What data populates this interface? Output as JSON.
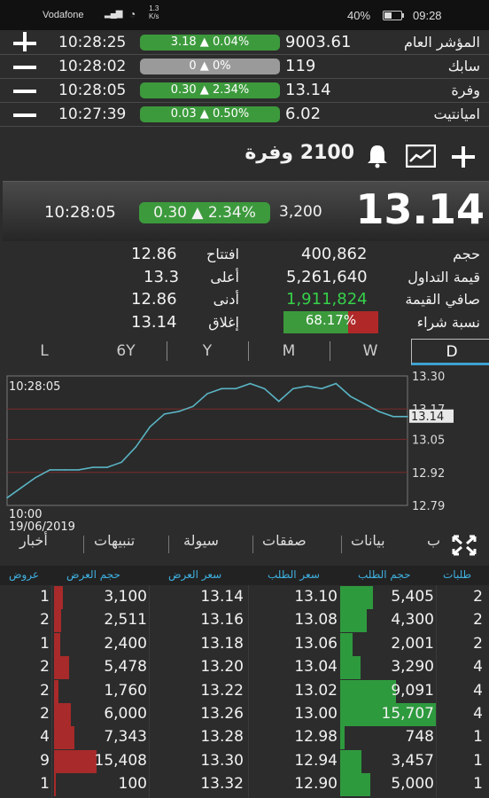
{
  "status_bar": {
    "carrier": "Vodafone",
    "network": "4G",
    "speed_top": "1.3",
    "speed_unit": "K/s",
    "battery": "40%",
    "time": "09:28"
  },
  "watchlist": [
    {
      "action": "plus",
      "time": "10:28:25",
      "change": "3.18 ▲ 0.04%",
      "price": "9003.61",
      "name": "المؤشر العام",
      "state": "up"
    },
    {
      "action": "minus",
      "time": "10:28:02",
      "change": "0 ▲ 0%",
      "price": "119",
      "name": "سابك",
      "state": "flat"
    },
    {
      "action": "minus",
      "time": "10:28:05",
      "change": "0.30 ▲ 2.34%",
      "price": "13.14",
      "name": "وفرة",
      "state": "up"
    },
    {
      "action": "minus",
      "time": "10:27:39",
      "change": "0.03 ▲ 0.50%",
      "price": "6.02",
      "name": "اميانتيت",
      "state": "up"
    }
  ],
  "header": {
    "title": "2100 وفرة"
  },
  "quote": {
    "price": "13.14",
    "volume": "3,200",
    "change": "0.30 ▲ 2.34%",
    "time": "10:28:05"
  },
  "stats": {
    "open_label": "افتتاح",
    "open": "12.86",
    "high_label": "أعلى",
    "high": "13.3",
    "low_label": "أدنى",
    "low": "12.86",
    "close_label": "إغلاق",
    "close": "13.14",
    "volume_label": "حجم",
    "volume": "400,862",
    "value_label": "قيمة التداول",
    "value": "5,261,640",
    "net_label": "صافي القيمة",
    "net": "1,911,824",
    "buy_ratio_label": "نسبة شراء",
    "buy_ratio": "68.17%",
    "buy_ratio_value": 0.6817
  },
  "period_tabs": [
    "L",
    "6Y",
    "Y",
    "M",
    "W",
    "D"
  ],
  "active_period": "D",
  "chart_data": {
    "type": "line",
    "title": "",
    "xlabel": "",
    "ylabel": "",
    "y_ticks": [
      "13.30",
      "13.17",
      "13.05",
      "12.92",
      "12.79"
    ],
    "ylim": [
      12.79,
      13.3
    ],
    "x_start_time": "10:00",
    "x_start_date": "19/06/2019",
    "last_time": "10:28:05",
    "last_value_label": "13.14",
    "x": [
      0,
      1,
      2,
      3,
      4,
      5,
      6,
      7,
      8,
      9,
      10,
      11,
      12,
      13,
      14,
      15,
      16,
      17,
      18,
      19,
      20,
      21,
      22,
      23,
      24,
      25,
      26,
      27,
      28
    ],
    "y": [
      12.82,
      12.86,
      12.9,
      12.93,
      12.93,
      12.93,
      12.94,
      12.94,
      12.96,
      13.02,
      13.1,
      13.15,
      13.16,
      13.18,
      13.23,
      13.25,
      13.25,
      13.27,
      13.25,
      13.2,
      13.25,
      13.26,
      13.25,
      13.27,
      13.22,
      13.19,
      13.16,
      13.14,
      13.14
    ],
    "grid": "horizontal",
    "line_color": "#5ab4c4"
  },
  "data_tabs": [
    "ب",
    "بيانات",
    "صفقات",
    "سيولة",
    "تنبيهات",
    "أخبار"
  ],
  "order_book": {
    "headers": {
      "bid_orders": "طلبات",
      "bid_volume": "حجم الطلب",
      "bid_price": "سعر الطلب",
      "ask_price": "سعر العرض",
      "ask_volume": "حجم العرض",
      "ask_orders": "عروض"
    },
    "rows": [
      {
        "ask_orders": "1",
        "ask_volume": "3,100",
        "ask_price": "13.14",
        "bid_price": "13.10",
        "bid_volume": "5,405",
        "bid_orders": "2",
        "ask_v": 3100,
        "bid_v": 5405
      },
      {
        "ask_orders": "2",
        "ask_volume": "2,511",
        "ask_price": "13.16",
        "bid_price": "13.08",
        "bid_volume": "4,300",
        "bid_orders": "2",
        "ask_v": 2511,
        "bid_v": 4300
      },
      {
        "ask_orders": "1",
        "ask_volume": "2,400",
        "ask_price": "13.18",
        "bid_price": "13.06",
        "bid_volume": "2,001",
        "bid_orders": "2",
        "ask_v": 2400,
        "bid_v": 2001
      },
      {
        "ask_orders": "2",
        "ask_volume": "5,478",
        "ask_price": "13.20",
        "bid_price": "13.04",
        "bid_volume": "3,290",
        "bid_orders": "4",
        "ask_v": 5478,
        "bid_v": 3290
      },
      {
        "ask_orders": "2",
        "ask_volume": "1,760",
        "ask_price": "13.22",
        "bid_price": "13.02",
        "bid_volume": "9,091",
        "bid_orders": "4",
        "ask_v": 1760,
        "bid_v": 9091
      },
      {
        "ask_orders": "2",
        "ask_volume": "6,000",
        "ask_price": "13.26",
        "bid_price": "13.00",
        "bid_volume": "15,707",
        "bid_orders": "4",
        "ask_v": 6000,
        "bid_v": 15707
      },
      {
        "ask_orders": "4",
        "ask_volume": "7,343",
        "ask_price": "13.28",
        "bid_price": "12.98",
        "bid_volume": "748",
        "bid_orders": "1",
        "ask_v": 7343,
        "bid_v": 748
      },
      {
        "ask_orders": "9",
        "ask_volume": "15,408",
        "ask_price": "13.30",
        "bid_price": "12.94",
        "bid_volume": "3,457",
        "bid_orders": "1",
        "ask_v": 15408,
        "bid_v": 3457
      },
      {
        "ask_orders": "1",
        "ask_volume": "100",
        "ask_price": "13.32",
        "bid_price": "12.90",
        "bid_volume": "5,000",
        "bid_orders": "1",
        "ask_v": 100,
        "bid_v": 5000
      }
    ]
  },
  "colors": {
    "up": "#3c9a3c",
    "flat": "#9a9a9a",
    "down": "#b02828",
    "accent": "#3fb0e0"
  }
}
